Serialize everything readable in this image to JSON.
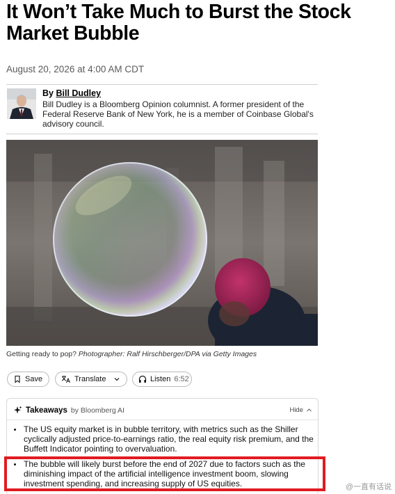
{
  "article": {
    "headline": "It Won’t Take Much to Burst the Stock Market Bubble",
    "date": "August 20, 2026 at 4:00 AM CDT",
    "byline_prefix": "By",
    "author": "Bill Dudley",
    "bio": "Bill Dudley is a Bloomberg Opinion columnist. A former president of the Federal Reserve Bank of New York, he is a member of Coinbase Global's advisory council.",
    "caption_text": "Getting ready to pop?",
    "caption_credit": "Photographer: Ralf Hirschberger/DPA via Getty Images"
  },
  "actions": {
    "save_label": "Save",
    "translate_label": "Translate",
    "listen_label": "Listen",
    "listen_duration": "6:52"
  },
  "takeaways": {
    "title": "Takeaways",
    "by": "by Bloomberg AI",
    "hide_label": "Hide",
    "items": [
      "The US equity market is in bubble territory, with metrics such as the Shiller cyclically adjusted price-to-earnings ratio, the real equity risk premium, and the Buffett Indicator pointing to overvaluation.",
      "The bubble will likely burst before the end of 2027 due to factors such as the diminishing impact of the artificial intelligence investment boom, slowing investment spending, and increasing supply of US equities."
    ]
  },
  "watermark": "@一直有话说",
  "colors": {
    "highlight": "#e11b22",
    "rule": "#cfcfcf",
    "muted_text": "#5a5a5a"
  }
}
